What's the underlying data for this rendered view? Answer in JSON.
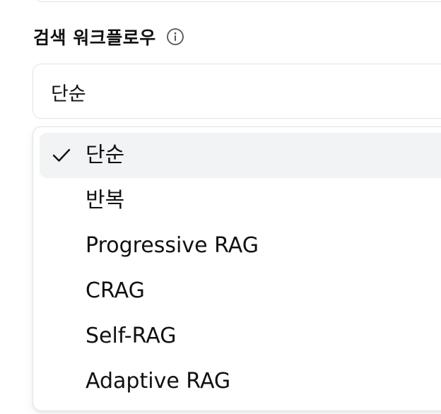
{
  "workflow": {
    "label": "검색 워크플로우",
    "selected_value": "단순",
    "options": [
      {
        "label": "단순",
        "selected": true
      },
      {
        "label": "반복",
        "selected": false
      },
      {
        "label": "Progressive RAG",
        "selected": false
      },
      {
        "label": "CRAG",
        "selected": false
      },
      {
        "label": "Self-RAG",
        "selected": false
      },
      {
        "label": "Adaptive RAG",
        "selected": false
      }
    ]
  },
  "icons": {
    "info": "info-icon",
    "check": "check-icon"
  },
  "colors": {
    "text": "#111111",
    "border": "#e1e3e7",
    "selected_bg": "#f2f3f5",
    "icon": "#555555"
  }
}
